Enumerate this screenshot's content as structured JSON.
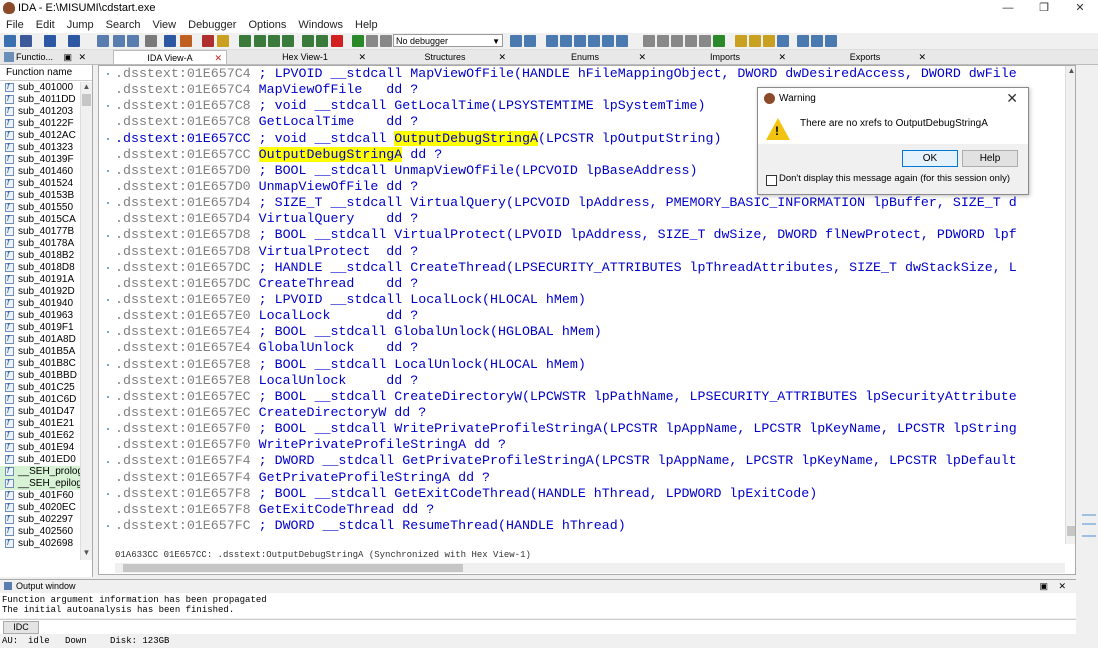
{
  "window": {
    "title": "IDA - E:\\MISUMI\\cdstart.exe",
    "controls": [
      "—",
      "❐",
      "✕"
    ]
  },
  "menu": [
    "File",
    "Edit",
    "Jump",
    "Search",
    "View",
    "Debugger",
    "Options",
    "Windows",
    "Help"
  ],
  "toolbar": {
    "debugger_select": "No debugger"
  },
  "tabs": [
    {
      "label": "Functio...",
      "active": false
    },
    {
      "label": "IDA View-A",
      "active": true
    },
    {
      "label": "Hex View-1",
      "active": false
    },
    {
      "label": "Structures",
      "active": false
    },
    {
      "label": "Enums",
      "active": false
    },
    {
      "label": "Imports",
      "active": false
    },
    {
      "label": "Exports",
      "active": false
    }
  ],
  "functions_panel": {
    "header": "Function name",
    "items": [
      "sub_401000",
      "sub_4011DD",
      "sub_401203",
      "sub_40122F",
      "sub_4012AC",
      "sub_401323",
      "sub_40139F",
      "sub_401460",
      "sub_401524",
      "sub_40153B",
      "sub_401550",
      "sub_4015CA",
      "sub_40177B",
      "sub_40178A",
      "sub_4018B2",
      "sub_4018D8",
      "sub_40191A",
      "sub_40192D",
      "sub_401940",
      "sub_401963",
      "sub_4019F1",
      "sub_401A8D",
      "sub_401B5A",
      "sub_401B8C",
      "sub_401BBD",
      "sub_401C25",
      "sub_401C6D",
      "sub_401D47",
      "sub_401E21",
      "sub_401E62",
      "sub_401E94",
      "sub_401ED0",
      "__SEH_prolog",
      "__SEH_epilog",
      "sub_401F60",
      "sub_4020EC",
      "sub_402297",
      "sub_402560",
      "sub_402698"
    ],
    "green_items": [
      "__SEH_prolog",
      "__SEH_epilog"
    ]
  },
  "listing": [
    {
      "addr": ".dsstext:01E657C4",
      "text": " ; LPVOID __stdcall MapViewOfFile(HANDLE hFileMappingObject, DWORD dwDesiredAccess, DWORD dwFile"
    },
    {
      "addr": ".dsstext:01E657C4",
      "text": " MapViewOfFile   dd ?"
    },
    {
      "addr": ".dsstext:01E657C8",
      "text": " ; void __stdcall GetLocalTime(LPSYSTEMTIME lpSystemTime)"
    },
    {
      "addr": ".dsstext:01E657C8",
      "text": " GetLocalTime    dd ?"
    },
    {
      "addr": ".dsstext:01E657CC",
      "text_pre": " ; void __stdcall ",
      "hl": "OutputDebugStringA",
      "text_post": "(LPCSTR lpOutputString)",
      "current": true
    },
    {
      "addr": ".dsstext:01E657CC",
      "text_pre": " ",
      "hl": "OutputDebugStringA",
      "text_post": " dd ?"
    },
    {
      "addr": ".dsstext:01E657D0",
      "text": " ; BOOL __stdcall UnmapViewOfFile(LPCVOID lpBaseAddress)"
    },
    {
      "addr": ".dsstext:01E657D0",
      "text": " UnmapViewOfFile dd ?"
    },
    {
      "addr": ".dsstext:01E657D4",
      "text": " ; SIZE_T __stdcall VirtualQuery(LPCVOID lpAddress, PMEMORY_BASIC_INFORMATION lpBuffer, SIZE_T d"
    },
    {
      "addr": ".dsstext:01E657D4",
      "text": " VirtualQuery    dd ?"
    },
    {
      "addr": ".dsstext:01E657D8",
      "text": " ; BOOL __stdcall VirtualProtect(LPVOID lpAddress, SIZE_T dwSize, DWORD flNewProtect, PDWORD lpf"
    },
    {
      "addr": ".dsstext:01E657D8",
      "text": " VirtualProtect  dd ?"
    },
    {
      "addr": ".dsstext:01E657DC",
      "text": " ; HANDLE __stdcall CreateThread(LPSECURITY_ATTRIBUTES lpThreadAttributes, SIZE_T dwStackSize, L"
    },
    {
      "addr": ".dsstext:01E657DC",
      "text": " CreateThread    dd ?"
    },
    {
      "addr": ".dsstext:01E657E0",
      "text": " ; LPVOID __stdcall LocalLock(HLOCAL hMem)"
    },
    {
      "addr": ".dsstext:01E657E0",
      "text": " LocalLock       dd ?"
    },
    {
      "addr": ".dsstext:01E657E4",
      "text": " ; BOOL __stdcall GlobalUnlock(HGLOBAL hMem)"
    },
    {
      "addr": ".dsstext:01E657E4",
      "text": " GlobalUnlock    dd ?"
    },
    {
      "addr": ".dsstext:01E657E8",
      "text": " ; BOOL __stdcall LocalUnlock(HLOCAL hMem)"
    },
    {
      "addr": ".dsstext:01E657E8",
      "text": " LocalUnlock     dd ?"
    },
    {
      "addr": ".dsstext:01E657EC",
      "text": " ; BOOL __stdcall CreateDirectoryW(LPCWSTR lpPathName, LPSECURITY_ATTRIBUTES lpSecurityAttribute"
    },
    {
      "addr": ".dsstext:01E657EC",
      "text": " CreateDirectoryW dd ?"
    },
    {
      "addr": ".dsstext:01E657F0",
      "text": " ; BOOL __stdcall WritePrivateProfileStringA(LPCSTR lpAppName, LPCSTR lpKeyName, LPCSTR lpString"
    },
    {
      "addr": ".dsstext:01E657F0",
      "text": " WritePrivateProfileStringA dd ?"
    },
    {
      "addr": ".dsstext:01E657F4",
      "text": " ; DWORD __stdcall GetPrivateProfileStringA(LPCSTR lpAppName, LPCSTR lpKeyName, LPCSTR lpDefault"
    },
    {
      "addr": ".dsstext:01E657F4",
      "text": " GetPrivateProfileStringA dd ?"
    },
    {
      "addr": ".dsstext:01E657F8",
      "text": " ; BOOL __stdcall GetExitCodeThread(HANDLE hThread, LPDWORD lpExitCode)"
    },
    {
      "addr": ".dsstext:01E657F8",
      "text": " GetExitCodeThread dd ?"
    },
    {
      "addr": ".dsstext:01E657FC",
      "text": " ; DWORD __stdcall ResumeThread(HANDLE hThread)"
    }
  ],
  "listing_status": "01A633CC 01E657CC: .dsstext:OutputDebugStringA (Synchronized with Hex View-1)",
  "dialog": {
    "title": "Warning",
    "message": "There are no xrefs to OutputDebugStringA",
    "ok": "OK",
    "help": "Help",
    "checkbox": "Don't display this message again (for this session only)"
  },
  "output": {
    "title": "Output window",
    "lines": [
      "Function argument information has been propagated",
      "The initial autoanalysis has been finished."
    ],
    "idc_button": "IDC"
  },
  "status": {
    "au": "AU:",
    "state": "idle",
    "direction": "Down",
    "disk": "Disk: 123GB"
  }
}
